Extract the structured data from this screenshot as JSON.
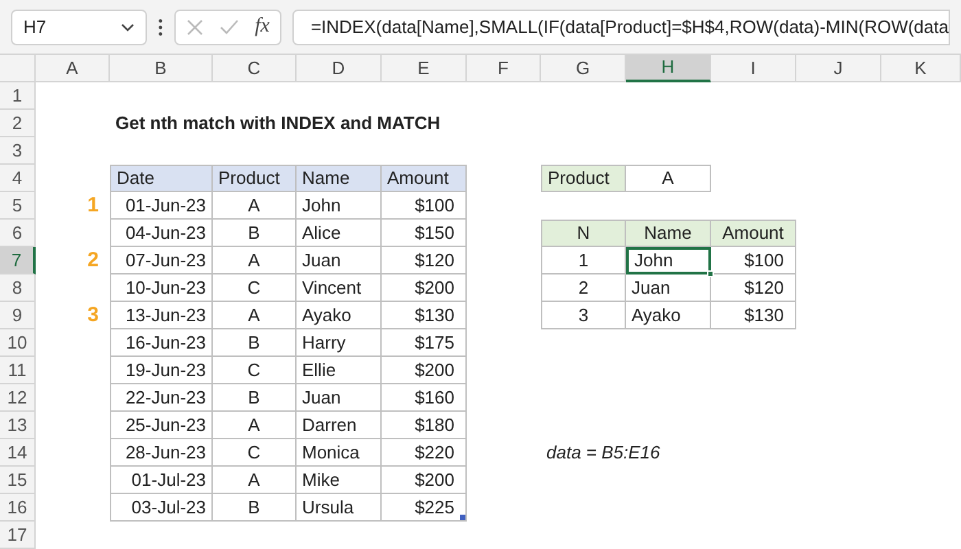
{
  "name_box": "H7",
  "fx_label": "fx",
  "formula": "=INDEX(data[Name],SMALL(IF(data[Product]=$H$4,ROW(data)-MIN(ROW(data",
  "column_headers": [
    {
      "label": "A",
      "selected": false
    },
    {
      "label": "B",
      "selected": false
    },
    {
      "label": "C",
      "selected": false
    },
    {
      "label": "D",
      "selected": false
    },
    {
      "label": "E",
      "selected": false
    },
    {
      "label": "F",
      "selected": false
    },
    {
      "label": "G",
      "selected": false
    },
    {
      "label": "H",
      "selected": true
    },
    {
      "label": "I",
      "selected": false
    },
    {
      "label": "J",
      "selected": false
    },
    {
      "label": "K",
      "selected": false
    }
  ],
  "row_headers": [
    {
      "label": "1",
      "selected": false
    },
    {
      "label": "2",
      "selected": false
    },
    {
      "label": "3",
      "selected": false
    },
    {
      "label": "4",
      "selected": false
    },
    {
      "label": "5",
      "selected": false
    },
    {
      "label": "6",
      "selected": false
    },
    {
      "label": "7",
      "selected": true
    },
    {
      "label": "8",
      "selected": false
    },
    {
      "label": "9",
      "selected": false
    },
    {
      "label": "10",
      "selected": false
    },
    {
      "label": "11",
      "selected": false
    },
    {
      "label": "12",
      "selected": false
    },
    {
      "label": "13",
      "selected": false
    },
    {
      "label": "14",
      "selected": false
    },
    {
      "label": "15",
      "selected": false
    },
    {
      "label": "16",
      "selected": false
    },
    {
      "label": "17",
      "selected": false
    }
  ],
  "title": "Get nth match with INDEX and MATCH",
  "data_table": {
    "columns": [
      "Date",
      "Product",
      "Name",
      "Amount"
    ],
    "rows": [
      {
        "marker": "1",
        "cells": [
          "01-Jun-23",
          "A",
          "John",
          "$100"
        ]
      },
      {
        "cells": [
          "04-Jun-23",
          "B",
          "Alice",
          "$150"
        ]
      },
      {
        "marker": "2",
        "cells": [
          "07-Jun-23",
          "A",
          "Juan",
          "$120"
        ]
      },
      {
        "cells": [
          "10-Jun-23",
          "C",
          "Vincent",
          "$200"
        ]
      },
      {
        "marker": "3",
        "cells": [
          "13-Jun-23",
          "A",
          "Ayako",
          "$130"
        ]
      },
      {
        "cells": [
          "16-Jun-23",
          "B",
          "Harry",
          "$175"
        ]
      },
      {
        "cells": [
          "19-Jun-23",
          "C",
          "Ellie",
          "$200"
        ]
      },
      {
        "cells": [
          "22-Jun-23",
          "B",
          "Juan",
          "$160"
        ]
      },
      {
        "cells": [
          "25-Jun-23",
          "A",
          "Darren",
          "$180"
        ]
      },
      {
        "cells": [
          "28-Jun-23",
          "C",
          "Monica",
          "$220"
        ]
      },
      {
        "cells": [
          "01-Jul-23",
          "A",
          "Mike",
          "$200"
        ]
      },
      {
        "cells": [
          "03-Jul-23",
          "B",
          "Ursula",
          "$225"
        ]
      }
    ]
  },
  "criteria": {
    "label": "Product",
    "value": "A"
  },
  "results_table": {
    "columns": [
      "N",
      "Name",
      "Amount"
    ],
    "rows": [
      {
        "selected": true,
        "cells": [
          "1",
          "John",
          "$100"
        ]
      },
      {
        "selected": false,
        "cells": [
          "2",
          "Juan",
          "$120"
        ]
      },
      {
        "selected": false,
        "cells": [
          "3",
          "Ayako",
          "$130"
        ]
      }
    ]
  },
  "note": "data = B5:E16"
}
